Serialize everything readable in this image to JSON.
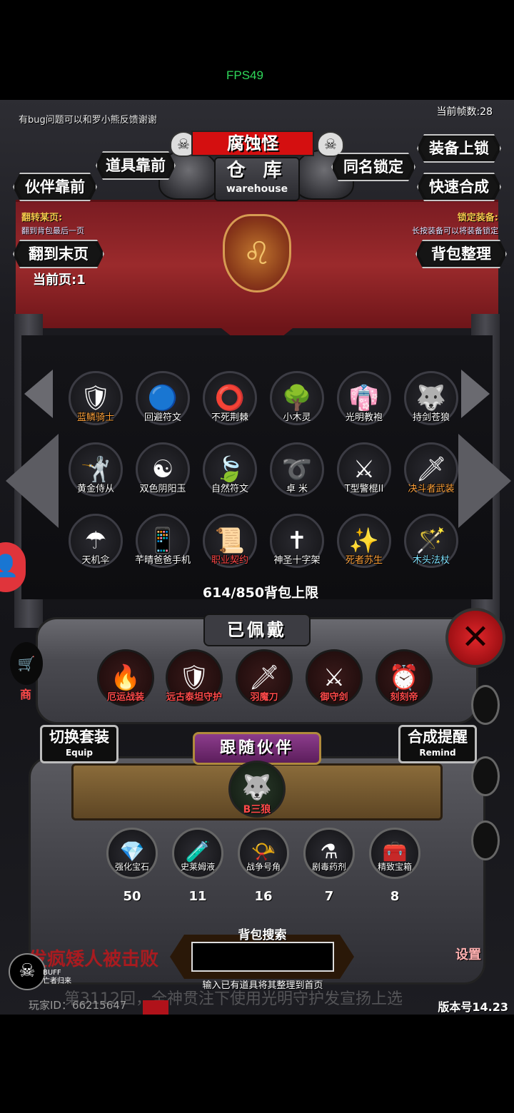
{
  "status": {
    "fps": "FPS49"
  },
  "header": {
    "bug_note": "有bug问题可以和罗小熊反馈谢谢",
    "frame_rate": "当前帧数:28",
    "monster_name": "腐蚀怪",
    "title_cn": "仓 库",
    "title_en": "warehouse"
  },
  "buttons": {
    "items_front": "道具靠前",
    "partner_front": "伙伴靠前",
    "same_name_lock": "同名锁定",
    "equip_lock": "装备上锁",
    "quick_craft": "快速合成",
    "go_last_page": "翻到末页",
    "sort_bag": "背包整理"
  },
  "hints": {
    "flip_label": "翻转某页:",
    "flip_sub": "翻到背包最后一页",
    "lock_label": "锁定装备:",
    "lock_sub": "长按装备可以将装备锁定",
    "current_page": "当前页:1"
  },
  "inventory": {
    "items": [
      {
        "name": "蓝鳞骑士",
        "icon": "knight-icon",
        "color": "orange"
      },
      {
        "name": "回避符文",
        "icon": "rune-icon",
        "color": "white"
      },
      {
        "name": "不死荆棘",
        "icon": "thorn-icon",
        "color": "white"
      },
      {
        "name": "小木灵",
        "icon": "tree-spirit-icon",
        "color": "white"
      },
      {
        "name": "光明教袍",
        "icon": "robe-icon",
        "color": "white"
      },
      {
        "name": "持剑苍狼",
        "icon": "wolf-icon",
        "color": "white"
      },
      {
        "name": "黄金侍从",
        "icon": "golden-squire-icon",
        "color": "white"
      },
      {
        "name": "双色阴阳玉",
        "icon": "yin-yang-jade-icon",
        "color": "white"
      },
      {
        "name": "自然符文",
        "icon": "nature-rune-icon",
        "color": "white"
      },
      {
        "name": "卓 米",
        "icon": "rope-icon",
        "color": "white"
      },
      {
        "name": "T型警棍II",
        "icon": "baton-icon",
        "color": "white"
      },
      {
        "name": "决斗者武装",
        "icon": "duelist-armor-icon",
        "color": "orange"
      },
      {
        "name": "天机伞",
        "icon": "umbrella-icon",
        "color": "white"
      },
      {
        "name": "芊晴爸爸手机",
        "icon": "phone-icon",
        "color": "white"
      },
      {
        "name": "职业契约",
        "icon": "scroll-icon",
        "color": "red"
      },
      {
        "name": "神圣十字架",
        "icon": "cross-icon",
        "color": "white"
      },
      {
        "name": "死者苏生",
        "icon": "revive-icon",
        "color": "orange"
      },
      {
        "name": "木头法杖",
        "icon": "staff-icon",
        "color": "cyan"
      }
    ],
    "capacity": "614/850背包上限"
  },
  "equipped": {
    "title": "已佩戴",
    "items": [
      {
        "name": "厄运战装",
        "icon": "doom-armor-icon"
      },
      {
        "name": "远古泰坦守护",
        "icon": "titan-guard-icon"
      },
      {
        "name": "羽魔刀",
        "icon": "feather-blade-icon"
      },
      {
        "name": "御守剑",
        "icon": "guardian-sword-icon"
      },
      {
        "name": "刻刻帝",
        "icon": "clock-emperor-icon"
      }
    ]
  },
  "panel": {
    "switch_set": "切换套装",
    "switch_set_en": "Equip",
    "craft_remind": "合成提醒",
    "craft_remind_en": "Remind",
    "follow_title": "跟随伙伴",
    "pet_name": "B三狼"
  },
  "consumables": [
    {
      "name": "强化宝石",
      "count": "50",
      "icon": "gem-icon"
    },
    {
      "name": "史莱姆液",
      "count": "11",
      "icon": "slime-potion-icon"
    },
    {
      "name": "战争号角",
      "count": "16",
      "icon": "war-horn-icon"
    },
    {
      "name": "剧毒药剂",
      "count": "7",
      "icon": "poison-potion-icon"
    },
    {
      "name": "精致宝箱",
      "count": "8",
      "icon": "treasure-chest-icon"
    }
  ],
  "search": {
    "title": "背包搜索",
    "placeholder": "",
    "hint": "输入已有道具将其整理到首页"
  },
  "footer": {
    "announcement": "发疯矮人被击败",
    "announcement2": "第3112回，全神贯注下使用光明守护发宣扬上选",
    "player_id": "玩家ID：66215647",
    "version": "版本号14.23",
    "settings": "设置",
    "buff_title": "BUFF",
    "buff_sub": "亡者归来",
    "shop": "商"
  },
  "colors": {
    "accent_red": "#d40f10",
    "orange_label": "#ffa23a",
    "red_label": "#ff4747",
    "fps_green": "#2fd85a"
  }
}
